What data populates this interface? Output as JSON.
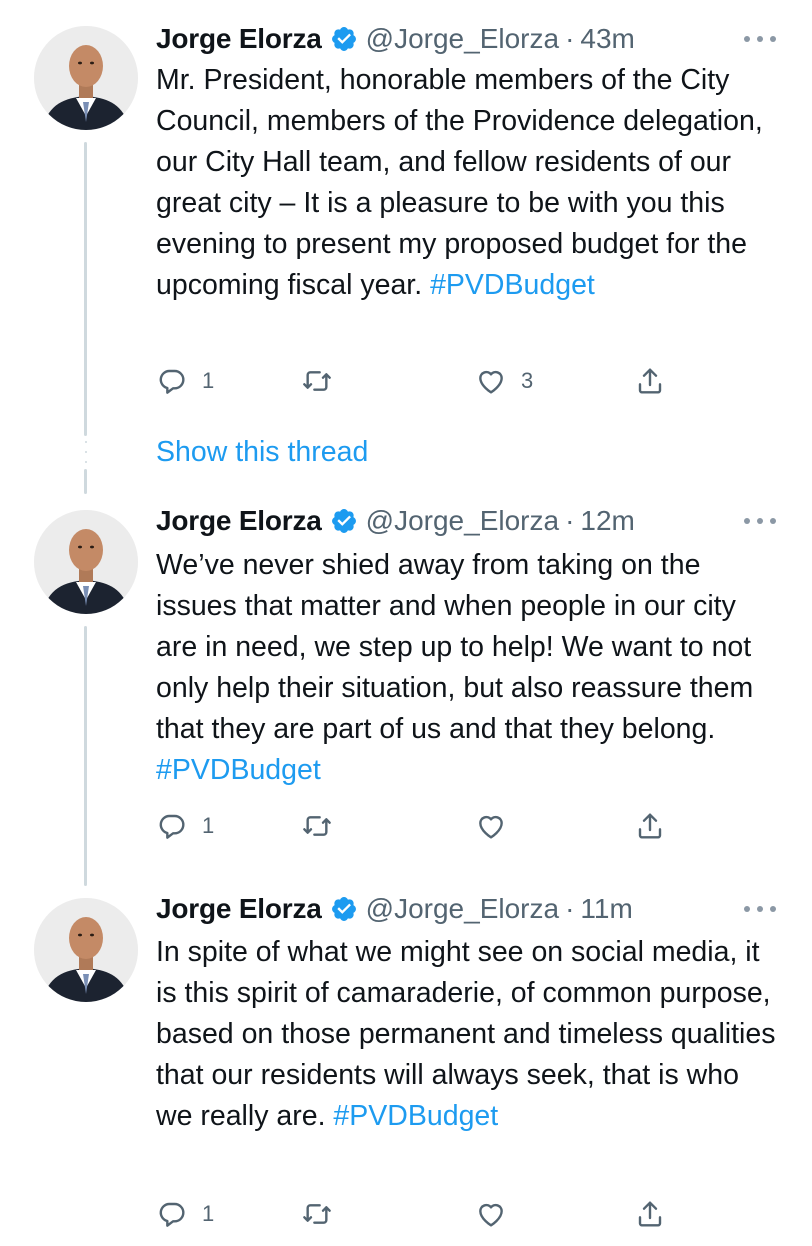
{
  "author": {
    "name": "Jorge Elorza",
    "handle": "@Jorge_Elorza"
  },
  "colors": {
    "link": "#1d9bf0",
    "muted": "#536471",
    "text": "#0f1419",
    "verified": "#1d9bf0"
  },
  "icons": {
    "reply": "reply-icon",
    "retweet": "retweet-icon",
    "like": "heart-icon",
    "share": "share-icon",
    "more": "more-icon",
    "verified": "verified-badge-icon"
  },
  "tweets": [
    {
      "time": "43m",
      "text": "Mr. President, honorable members of the City Council, members of the Providence delegation, our City Hall team, and fellow residents of our great city – It is a pleasure to be with you this evening to present my proposed budget for the upcoming fiscal year.",
      "hashtag": "#PVDBudget",
      "replies": "1",
      "retweets": "",
      "likes": "3"
    },
    {
      "time": "12m",
      "text": "We’ve never shied away from taking on the issues that matter and when people in our city are in need, we step up to help! We want to not only help their situation, but also reassure them that they are part of us and that they belong.",
      "hashtag": "#PVDBudget",
      "replies": "1",
      "retweets": "",
      "likes": ""
    },
    {
      "time": "11m",
      "text": "In spite of what we might see on social media, it is this spirit of camaraderie, of common purpose, based on those permanent and timeless qualities that our residents will always seek, that is who we really are.",
      "hashtag": "#PVDBudget",
      "replies": "1",
      "retweets": "",
      "likes": ""
    }
  ],
  "show_thread": "Show this thread"
}
